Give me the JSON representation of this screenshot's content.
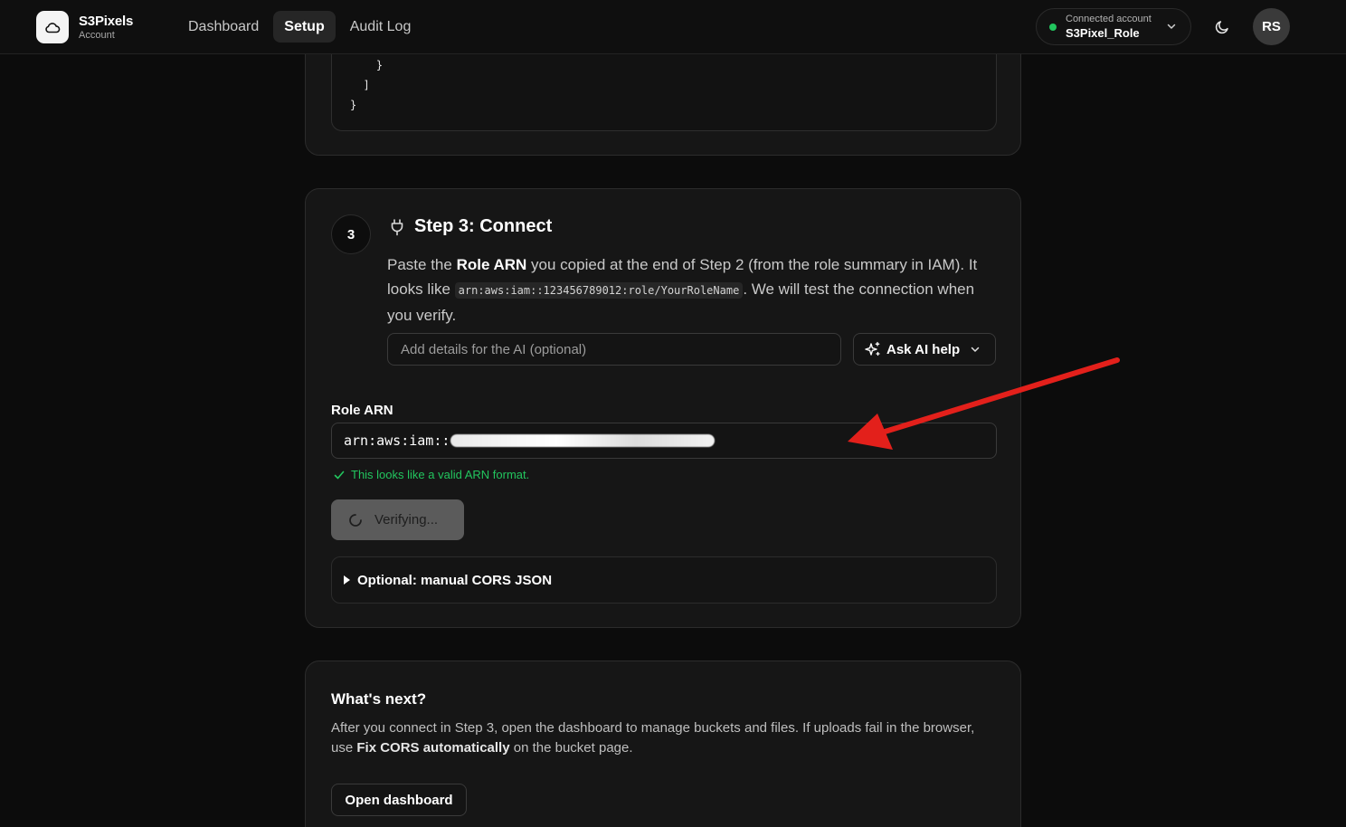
{
  "brand": {
    "name": "S3Pixels",
    "sub": "Account"
  },
  "nav": {
    "items": [
      "Dashboard",
      "Setup",
      "Audit Log"
    ],
    "active": "Setup"
  },
  "account": {
    "label": "Connected account",
    "value": "S3Pixel_Role"
  },
  "user": {
    "initials": "RS"
  },
  "code_snippet": {
    "lines": [
      "    }",
      "  ]",
      "}"
    ]
  },
  "step3": {
    "number": "3",
    "title": "Step 3: Connect",
    "desc_1": "Paste the ",
    "desc_bold": "Role ARN",
    "desc_2": " you copied at the end of Step 2 (from the role summary in IAM). It looks like ",
    "desc_code": "arn:aws:iam::123456789012:role/YourRoleName",
    "desc_3": ". We will test the connection when you verify.",
    "ai_placeholder": "Add details for the AI (optional)",
    "ai_button": "Ask AI help",
    "field_label": "Role ARN",
    "arn_visible_prefix": "arn:aws:iam::",
    "valid_message": "This looks like a valid ARN format.",
    "verify_label": "Verifying...",
    "details_label": "Optional: manual CORS JSON"
  },
  "next": {
    "title": "What's next?",
    "text_1": "After you connect in Step 3, open the dashboard to manage buckets and files. If uploads fail in the browser, use ",
    "text_bold": "Fix CORS automatically",
    "text_2": " on the bucket page.",
    "button": "Open dashboard"
  },
  "colors": {
    "accent_green": "#22c55e",
    "annotation_arrow": "#e3201b"
  },
  "icons": [
    "cloud-icon",
    "chevron-down-icon",
    "moon-icon",
    "plug-icon",
    "sparkles-icon",
    "check-icon",
    "spinner-icon",
    "triangle-right-icon",
    "annotation-arrow"
  ]
}
